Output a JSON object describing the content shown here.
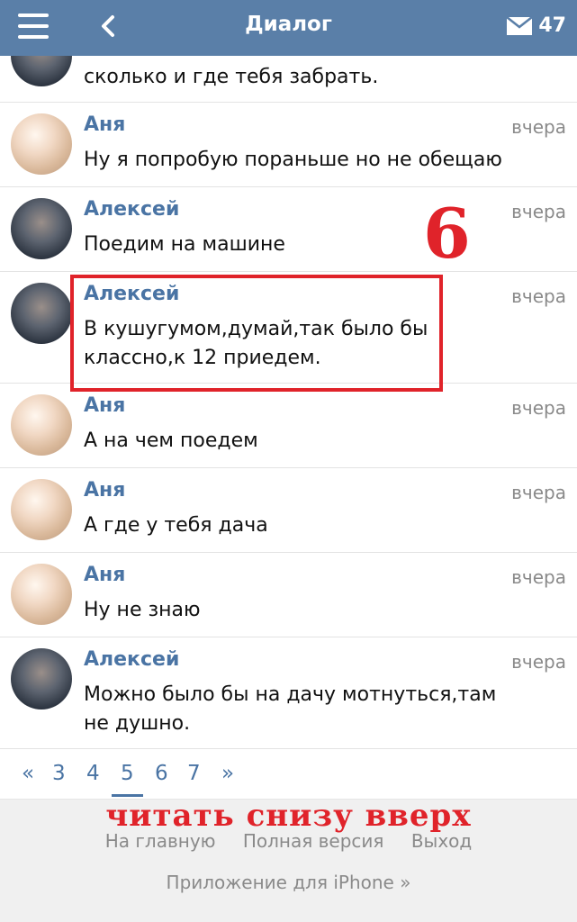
{
  "header": {
    "title": "Диалог",
    "mail_count": "47"
  },
  "partial_message": {
    "text": "сколько и где тебя забрать."
  },
  "messages": [
    {
      "author": "Аня",
      "time": "вчера",
      "text": "Ну я попробую пораньше но не обещаю",
      "avatar": "anya-avatar"
    },
    {
      "author": "Алексей",
      "time": "вчера",
      "text": "Поедим на машине",
      "avatar": "alexey-avatar"
    },
    {
      "author": "Алексей",
      "time": "вчера",
      "text": "В кушугумом,думай,так было бы классно,к 12 приедем.",
      "avatar": "alexey-avatar"
    },
    {
      "author": "Аня",
      "time": "вчера",
      "text": "А на чем поедем",
      "avatar": "anya-avatar"
    },
    {
      "author": "Аня",
      "time": "вчера",
      "text": "А где у тебя дача",
      "avatar": "anya-avatar"
    },
    {
      "author": "Аня",
      "time": "вчера",
      "text": "Ну не знаю",
      "avatar": "anya-avatar"
    },
    {
      "author": "Алексей",
      "time": "вчера",
      "text": "Можно было бы на дачу мотнуться,там не душно.",
      "avatar": "alexey-avatar"
    }
  ],
  "annotations": {
    "number": "6",
    "caption": "читать снизу вверх"
  },
  "pagination": {
    "prev": "«",
    "pages": [
      "3",
      "4",
      "5",
      "6",
      "7"
    ],
    "active": "5",
    "next": "»"
  },
  "footer": {
    "home": "На главную",
    "full_version": "Полная версия",
    "logout": "Выход",
    "iphone_app": "Приложение для iPhone »"
  },
  "colors": {
    "header_bg": "#5a7fa8",
    "author": "#4a74a4",
    "annotation_red": "#e0232a"
  }
}
